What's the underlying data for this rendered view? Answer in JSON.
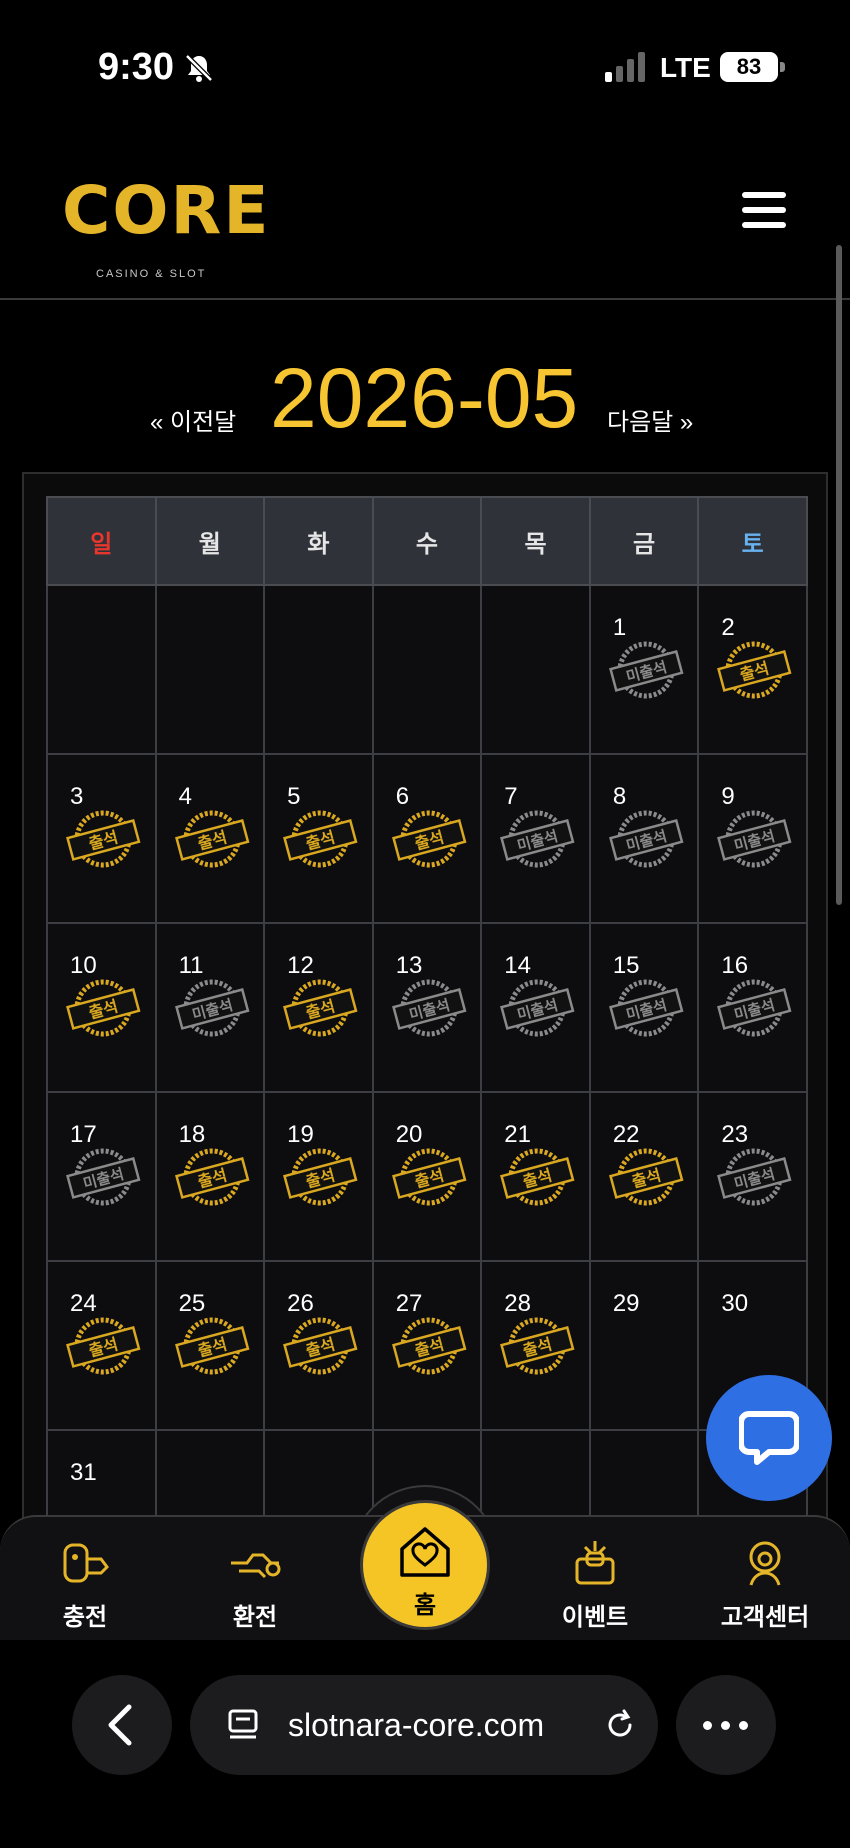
{
  "status_bar": {
    "time": "9:30",
    "network": "LTE",
    "battery": "83"
  },
  "header": {
    "logo_text": "CORE",
    "logo_subtitle": "CASINO & SLOT",
    "menu_icon": "hamburger-icon"
  },
  "calendar": {
    "month": "2026-05",
    "prev_label": "« 이전달",
    "next_label": "다음달 »",
    "weekdays": [
      "일",
      "월",
      "화",
      "수",
      "목",
      "금",
      "토"
    ],
    "stamp_attended": "출석",
    "stamp_absent": "미출석",
    "weeks": [
      [
        {
          "day": ""
        },
        {
          "day": ""
        },
        {
          "day": ""
        },
        {
          "day": ""
        },
        {
          "day": ""
        },
        {
          "day": "1",
          "status": "absent"
        },
        {
          "day": "2",
          "status": "attended"
        }
      ],
      [
        {
          "day": "3",
          "status": "attended"
        },
        {
          "day": "4",
          "status": "attended"
        },
        {
          "day": "5",
          "status": "attended"
        },
        {
          "day": "6",
          "status": "attended"
        },
        {
          "day": "7",
          "status": "absent"
        },
        {
          "day": "8",
          "status": "absent"
        },
        {
          "day": "9",
          "status": "absent"
        }
      ],
      [
        {
          "day": "10",
          "status": "attended"
        },
        {
          "day": "11",
          "status": "absent"
        },
        {
          "day": "12",
          "status": "attended"
        },
        {
          "day": "13",
          "status": "absent"
        },
        {
          "day": "14",
          "status": "absent"
        },
        {
          "day": "15",
          "status": "absent"
        },
        {
          "day": "16",
          "status": "absent"
        }
      ],
      [
        {
          "day": "17",
          "status": "absent"
        },
        {
          "day": "18",
          "status": "attended"
        },
        {
          "day": "19",
          "status": "attended"
        },
        {
          "day": "20",
          "status": "attended"
        },
        {
          "day": "21",
          "status": "attended"
        },
        {
          "day": "22",
          "status": "attended"
        },
        {
          "day": "23",
          "status": "absent"
        }
      ],
      [
        {
          "day": "24",
          "status": "attended"
        },
        {
          "day": "25",
          "status": "attended"
        },
        {
          "day": "26",
          "status": "attended"
        },
        {
          "day": "27",
          "status": "attended"
        },
        {
          "day": "28",
          "status": "attended"
        },
        {
          "day": "29"
        },
        {
          "day": "30"
        }
      ],
      [
        {
          "day": "31"
        },
        {
          "day": ""
        },
        {
          "day": ""
        },
        {
          "day": ""
        },
        {
          "day": ""
        },
        {
          "day": ""
        },
        {
          "day": ""
        }
      ]
    ]
  },
  "bottom_nav": {
    "items": [
      {
        "label": "충전",
        "icon": "deposit-icon"
      },
      {
        "label": "환전",
        "icon": "withdraw-icon"
      },
      {
        "label": "홈",
        "icon": "home-icon"
      },
      {
        "label": "이벤트",
        "icon": "gift-icon"
      },
      {
        "label": "고객센터",
        "icon": "support-icon"
      }
    ]
  },
  "browser": {
    "url": "slotnara-core.com"
  },
  "colors": {
    "accent": "#f5c525",
    "gold_stamp": "#d9a820",
    "absent_stamp": "#8a8a8a",
    "chat": "#2f6fe4"
  }
}
